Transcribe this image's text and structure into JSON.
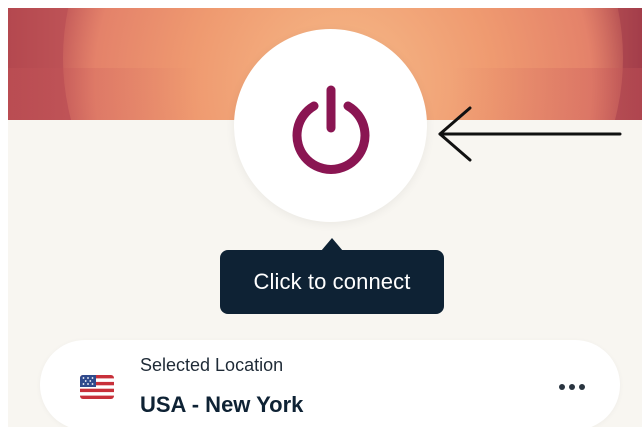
{
  "power_button": {
    "icon": "power-icon",
    "color": "#8a1552"
  },
  "annotation": {
    "icon": "arrow-left-icon"
  },
  "tooltip": {
    "text": "Click to connect",
    "background": "#0e2234"
  },
  "location": {
    "caption": "Selected Location",
    "value": "USA - New York",
    "flag_icon": "us-flag-icon",
    "more_icon": "more-horizontal-icon"
  }
}
